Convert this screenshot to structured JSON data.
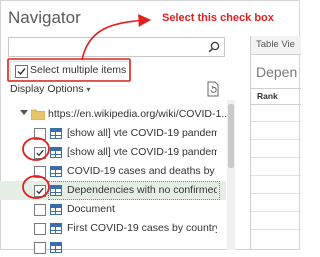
{
  "navigator": {
    "title": "Navigator",
    "search": {
      "placeholder": "",
      "icon": "search-icon"
    },
    "select_multiple": {
      "label": "Select multiple items",
      "checked": true
    },
    "display_options": {
      "label": "Display Options",
      "caret": "▾"
    },
    "refresh_icon": "refresh-icon",
    "source_url": "https://en.wikipedia.org/wiki/COVID-1...",
    "items": [
      {
        "label": "[show all] vte COVID-19 pandemi...",
        "checked": false,
        "selected": false
      },
      {
        "label": "[show all] vte COVID-19 pandemi...",
        "checked": true,
        "selected": false
      },
      {
        "label": "COVID-19 cases and deaths by re...",
        "checked": false,
        "selected": false
      },
      {
        "label": "Dependencies with no confirmed...",
        "checked": true,
        "selected": true
      },
      {
        "label": "Document",
        "checked": false,
        "selected": false
      },
      {
        "label": "First COVID-19 cases by country...",
        "checked": false,
        "selected": false
      },
      {
        "label": "",
        "checked": false,
        "selected": false
      }
    ]
  },
  "preview": {
    "tab_label": "Table Vie",
    "title": "Depen",
    "column_header": "Rank"
  },
  "annotation": {
    "callout_text": "Select this check box",
    "color": "#e0201d"
  }
}
